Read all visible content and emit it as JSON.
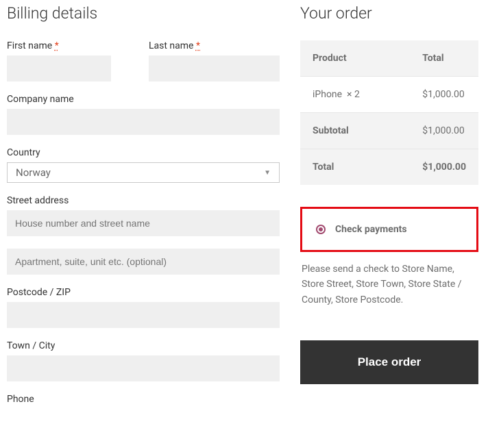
{
  "billing": {
    "heading": "Billing details",
    "first_name_label": "First name",
    "last_name_label": "Last name",
    "required_mark": "*",
    "company_label": "Company name",
    "country_label": "Country",
    "country_value": "Norway",
    "street_label": "Street address",
    "street_placeholder": "House number and street name",
    "apt_placeholder": "Apartment, suite, unit etc. (optional)",
    "postcode_label": "Postcode / ZIP",
    "town_label": "Town / City",
    "phone_label": "Phone"
  },
  "order": {
    "heading": "Your order",
    "product_header": "Product",
    "total_header": "Total",
    "item_name": "iPhone",
    "item_qty": "× 2",
    "item_total": "$1,000.00",
    "subtotal_label": "Subtotal",
    "subtotal_value": "$1,000.00",
    "total_label": "Total",
    "total_value": "$1,000.00"
  },
  "payment": {
    "method_label": "Check payments",
    "description": "Please send a check to Store Name, Store Street, Store Town, Store State / County, Store Postcode."
  },
  "buttons": {
    "place_order": "Place order"
  }
}
